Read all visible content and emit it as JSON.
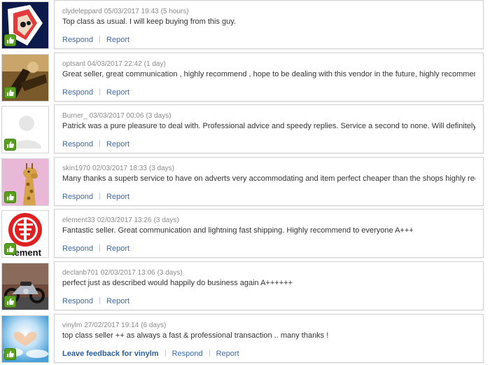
{
  "feedback": [
    {
      "user": "clydeleppard",
      "date": "05/03/2017 19:43",
      "ago": "(5 hours)",
      "message": "Top class as usual. I will keep buying from this guy.",
      "avatar_icon": "album-art-avatar",
      "actions": {
        "respond": "Respond",
        "report": "Report"
      }
    },
    {
      "user": "optsant",
      "date": "04/03/2017 22:42",
      "ago": "(1 day)",
      "message": "Great seller, great communication , highly recommend , hope to be dealing with this vendor in the future, highly recommend A+++",
      "avatar_icon": "photo-avatar",
      "actions": {
        "respond": "Respond",
        "report": "Report"
      }
    },
    {
      "user": "Burner_",
      "date": "03/03/2017 00:06",
      "ago": "(3 days)",
      "message": "Patrick was a pure pleasure to deal with. Professional advice and speedy replies. Service a second to none. Will definitely come back.",
      "avatar_icon": "default-person-avatar",
      "actions": {
        "respond": "Respond",
        "report": "Report"
      }
    },
    {
      "user": "skin1970",
      "date": "02/03/2017 18:33",
      "ago": "(3 days)",
      "message": "Many thanks a superb service to have on adverts very accommodating and item perfect cheaper than the shops highly recommend",
      "avatar_icon": "giraffe-avatar",
      "actions": {
        "respond": "Respond",
        "report": "Report"
      }
    },
    {
      "user": "element33",
      "date": "02/03/2017 13:26",
      "ago": "(3 days)",
      "message": "Fantastic seller. Great communication and lightning fast shipping. Highly recommend to everyone A+++",
      "avatar_icon": "element-logo-avatar",
      "avatar_text": "lement",
      "actions": {
        "respond": "Respond",
        "report": "Report"
      }
    },
    {
      "user": "declanb701",
      "date": "02/03/2017 13:06",
      "ago": "(3 days)",
      "message": "perfect just as described would happily do business again A++++++",
      "avatar_icon": "motorcycle-avatar",
      "actions": {
        "respond": "Respond",
        "report": "Report"
      }
    },
    {
      "user": "vinylm",
      "date": "27/02/2017 19:14",
      "ago": "(6 days)",
      "message": "top class seller ++ as always a fast & professional transaction .. many thanks !",
      "avatar_icon": "sky-heart-avatar",
      "actions": {
        "leave": "Leave feedback for vinylm",
        "respond": "Respond",
        "report": "Report"
      }
    }
  ],
  "colors": {
    "link": "#3b6aa8",
    "positive": "#5aa020",
    "meta": "#8a8a8a"
  }
}
